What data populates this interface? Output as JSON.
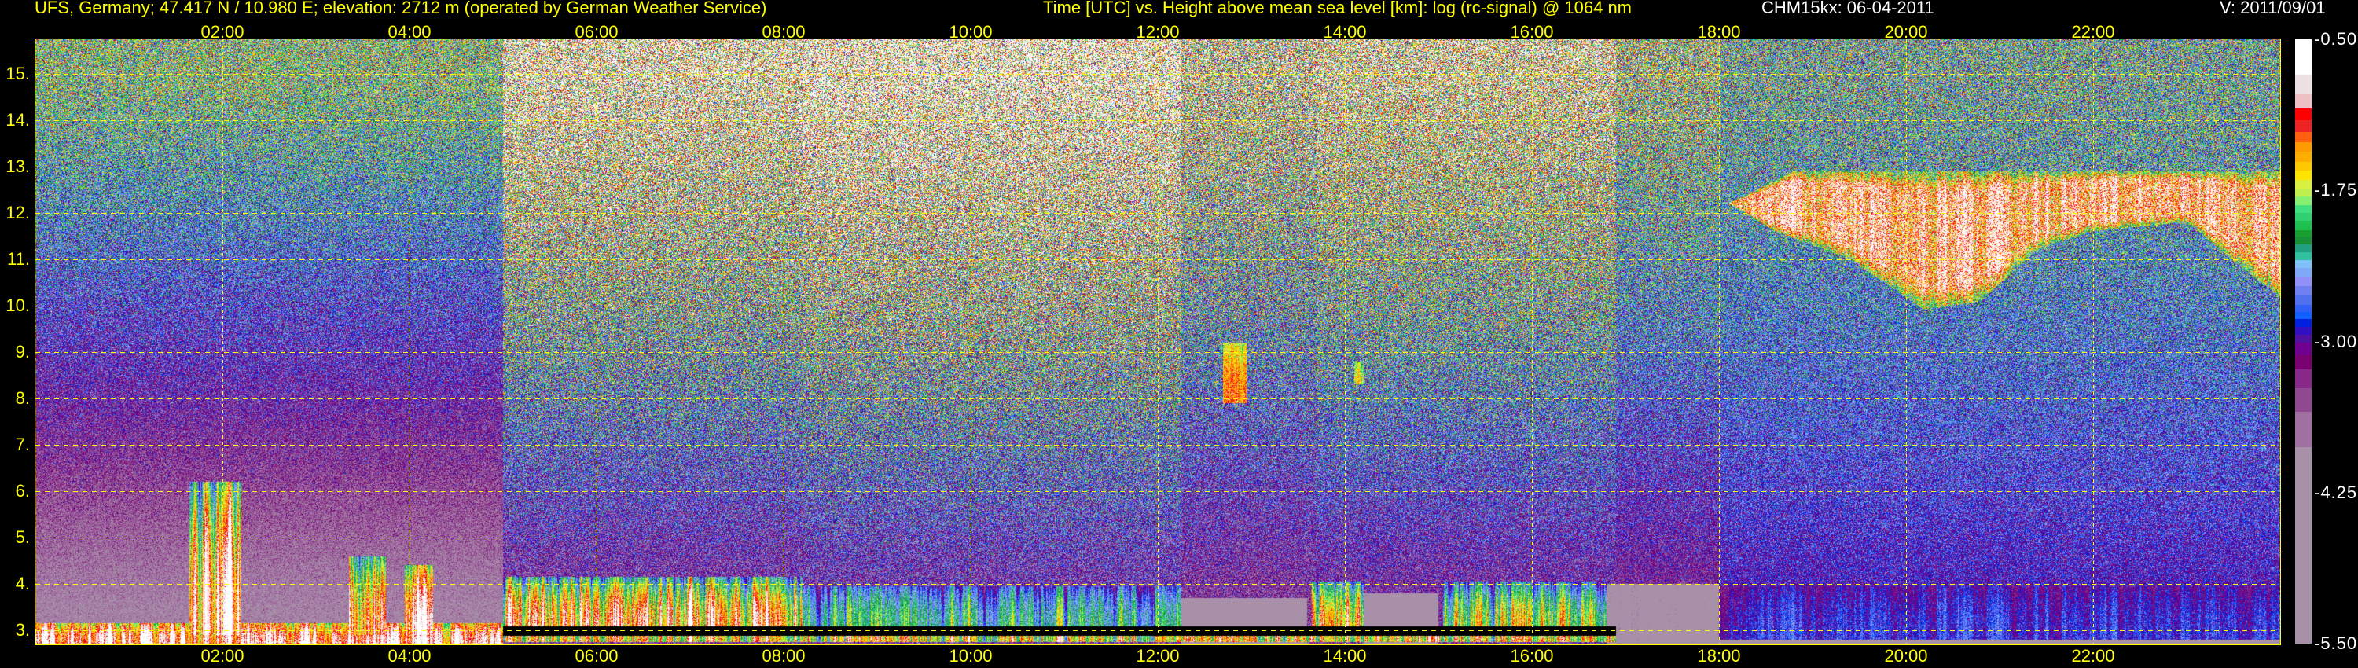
{
  "header": {
    "station": "UFS, Germany; 47.417 N / 10.980 E; elevation: 2712 m  (operated by German Weather Service)",
    "title": "Time [UTC] vs. Height above mean sea level [km]: log (rc-signal) @ 1064 nm",
    "instrument": "CHM15kx: 06-04-2011",
    "version": "V: 2011/09/01"
  },
  "colors": {
    "axis": "#ffff00",
    "grid": "#ffff00",
    "background": "#000000",
    "text_white": "#ffffff"
  },
  "chart_data": {
    "type": "heatmap",
    "title": "Time [UTC] vs. Height above mean sea level [km]: log (rc-signal) @ 1064 nm",
    "xlabel": "Time [UTC]",
    "ylabel": "Height above mean sea level [km]",
    "xlim": [
      0,
      24
    ],
    "ylim": [
      2.712,
      15.74
    ],
    "grid": true,
    "x_ticks": [
      2,
      4,
      6,
      8,
      10,
      12,
      14,
      16,
      18,
      20,
      22
    ],
    "x_tick_labels": [
      "02:00",
      "04:00",
      "06:00",
      "08:00",
      "10:00",
      "12:00",
      "14:00",
      "16:00",
      "18:00",
      "20:00",
      "22:00"
    ],
    "y_ticks": [
      3,
      4,
      5,
      6,
      7,
      8,
      9,
      10,
      11,
      12,
      13,
      14,
      15
    ],
    "y_tick_labels": [
      "3.",
      "4.",
      "5.",
      "6.",
      "7.",
      "8.",
      "9.",
      "10.",
      "11.",
      "12.",
      "13.",
      "14.",
      "15."
    ],
    "colorbar": {
      "range": [
        -5.5,
        -0.5
      ],
      "tick_values": [
        -0.5,
        -1.75,
        -3.0,
        -4.25,
        -5.5
      ],
      "tick_labels": [
        "-0.50",
        "-1.75",
        "-3.00",
        "-4.25",
        "-5.50"
      ],
      "segments": [
        {
          "from": -0.792,
          "to": -0.5,
          "color": "#ffffff"
        },
        {
          "from": -0.958,
          "to": -0.792,
          "color": "#ebe0e2"
        },
        {
          "from": -1.074,
          "to": -0.958,
          "color": "#efc0c4"
        },
        {
          "from": -1.169,
          "to": -1.074,
          "color": "#ff0000"
        },
        {
          "from": -1.268,
          "to": -1.169,
          "color": "#ee2424"
        },
        {
          "from": -1.352,
          "to": -1.268,
          "color": "#ff6010"
        },
        {
          "from": -1.433,
          "to": -1.352,
          "color": "#ff9a00"
        },
        {
          "from": -1.514,
          "to": -1.433,
          "color": "#ffae00"
        },
        {
          "from": -1.584,
          "to": -1.514,
          "color": "#ffc800"
        },
        {
          "from": -1.666,
          "to": -1.584,
          "color": "#ffe400"
        },
        {
          "from": -1.736,
          "to": -1.666,
          "color": "#d8f040"
        },
        {
          "from": -1.803,
          "to": -1.736,
          "color": "#bff050"
        },
        {
          "from": -1.87,
          "to": -1.803,
          "color": "#88f070"
        },
        {
          "from": -1.937,
          "to": -1.87,
          "color": "#40e080"
        },
        {
          "from": -2.0,
          "to": -1.937,
          "color": "#30d070"
        },
        {
          "from": -2.077,
          "to": -2.0,
          "color": "#20c050"
        },
        {
          "from": -2.13,
          "to": -2.077,
          "color": "#17a030"
        },
        {
          "from": -2.197,
          "to": -2.13,
          "color": "#189038"
        },
        {
          "from": -2.264,
          "to": -2.197,
          "color": "#20a080"
        },
        {
          "from": -2.324,
          "to": -2.264,
          "color": "#30c0a0"
        },
        {
          "from": -2.394,
          "to": -2.324,
          "color": "#80c0f8"
        },
        {
          "from": -2.465,
          "to": -2.394,
          "color": "#80a8f8"
        },
        {
          "from": -2.542,
          "to": -2.465,
          "color": "#9090f8"
        },
        {
          "from": -2.62,
          "to": -2.542,
          "color": "#7080f0"
        },
        {
          "from": -2.697,
          "to": -2.62,
          "color": "#5070f0"
        },
        {
          "from": -2.757,
          "to": -2.697,
          "color": "#3060f8"
        },
        {
          "from": -2.817,
          "to": -2.757,
          "color": "#1060ff"
        },
        {
          "from": -2.88,
          "to": -2.817,
          "color": "#0020e0"
        },
        {
          "from": -2.947,
          "to": -2.88,
          "color": "#3010c0"
        },
        {
          "from": -3.011,
          "to": -2.947,
          "color": "#5010a0"
        },
        {
          "from": -3.116,
          "to": -3.011,
          "color": "#700090"
        },
        {
          "from": -3.232,
          "to": -3.116,
          "color": "#780070"
        },
        {
          "from": -3.387,
          "to": -3.232,
          "color": "#882888"
        },
        {
          "from": -3.585,
          "to": -3.387,
          "color": "#904890"
        },
        {
          "from": -3.873,
          "to": -3.585,
          "color": "#a070a0"
        },
        {
          "from": -5.5,
          "to": -3.873,
          "color": "#a890a8"
        }
      ]
    },
    "background": [
      {
        "t": [
          0,
          5
        ],
        "low": -3.9,
        "high": -2.0,
        "noise": 0.55
      },
      {
        "t": [
          5,
          8.2
        ],
        "low": -3.4,
        "high": -1.2,
        "noise": 1.0
      },
      {
        "t": [
          8.2,
          12.25
        ],
        "low": -3.3,
        "high": -1.0,
        "noise": 1.1
      },
      {
        "t": [
          12.25,
          13.7
        ],
        "low": -3.4,
        "high": -1.6,
        "noise": 0.9
      },
      {
        "t": [
          13.7,
          16.9
        ],
        "low": -3.3,
        "high": -1.4,
        "noise": 0.9
      },
      {
        "t": [
          16.9,
          18
        ],
        "low": -3.3,
        "high": -1.9,
        "noise": 0.7
      },
      {
        "t": [
          18,
          24
        ],
        "low": -3.0,
        "high": -2.2,
        "noise": 0.6
      }
    ],
    "features": [
      {
        "name": "surface-layer-night",
        "t": [
          0,
          5
        ],
        "h": [
          2.712,
          3.15
        ],
        "v": -1.0,
        "fade": 0.6,
        "streak": 0.4
      },
      {
        "name": "convective-plume",
        "t": [
          1.65,
          2.2
        ],
        "h": [
          2.9,
          6.2
        ],
        "v": -0.8,
        "fade": 1.2,
        "streak": 0.6
      },
      {
        "name": "convective-plume",
        "t": [
          3.35,
          3.75
        ],
        "h": [
          2.9,
          4.6
        ],
        "v": -1.3,
        "fade": 1.0,
        "streak": 0.6
      },
      {
        "name": "convective-plume",
        "t": [
          3.95,
          4.25
        ],
        "h": [
          2.9,
          4.4
        ],
        "v": -1.0,
        "fade": 1.0,
        "streak": 0.5
      },
      {
        "name": "boundary-layer",
        "t": [
          5.0,
          8.2
        ],
        "h": [
          3.08,
          4.15
        ],
        "v": -1.3,
        "fade": 1.1,
        "streak": 0.6
      },
      {
        "name": "boundary-layer",
        "t": [
          8.2,
          12.25
        ],
        "h": [
          3.08,
          3.95
        ],
        "v": -2.15,
        "fade": 0.6,
        "streak": 0.4
      },
      {
        "name": "no-signal-gap",
        "t": [
          12.25,
          13.6
        ],
        "h": [
          2.712,
          3.7
        ],
        "v": -4.6,
        "fade": 0,
        "streak": 0.2
      },
      {
        "name": "boundary-layer",
        "t": [
          13.65,
          14.2
        ],
        "h": [
          3.08,
          4.05
        ],
        "v": -1.4,
        "fade": 1.0,
        "streak": 0.5
      },
      {
        "name": "no-signal-gap",
        "t": [
          14.2,
          15.0
        ],
        "h": [
          2.712,
          3.8
        ],
        "v": -4.6,
        "fade": 0,
        "streak": 0.2
      },
      {
        "name": "boundary-layer",
        "t": [
          15.05,
          16.8
        ],
        "h": [
          3.08,
          4.05
        ],
        "v": -1.8,
        "fade": 0.9,
        "streak": 0.5
      },
      {
        "name": "evening-gap",
        "t": [
          16.8,
          18.0
        ],
        "h": [
          2.712,
          4.0
        ],
        "v": -4.3,
        "fade": 0,
        "streak": 0.2
      },
      {
        "name": "residual-layer",
        "t": [
          18.0,
          24
        ],
        "h": [
          2.8,
          3.95
        ],
        "v": -2.85,
        "fade": 0.2,
        "streak": 0.15
      },
      {
        "name": "surface-thin",
        "t": [
          18.0,
          24
        ],
        "h": [
          2.712,
          2.8
        ],
        "v": -4.5,
        "fade": 0,
        "streak": 0
      },
      {
        "name": "no-signal-band",
        "t": [
          5.0,
          16.9
        ],
        "h": [
          2.88,
          3.08
        ],
        "v": -9,
        "fade": 0,
        "streak": 0
      },
      {
        "name": "surface-layer-day",
        "t": [
          5.0,
          16.9
        ],
        "h": [
          2.74,
          2.88
        ],
        "v": -1.6,
        "fade": 0,
        "streak": 0.6
      },
      {
        "name": "aerosol-patch",
        "t": [
          12.7,
          12.95
        ],
        "h": [
          7.9,
          9.2
        ],
        "v": -1.4,
        "fade": 0.4,
        "streak": 0.2
      },
      {
        "name": "aerosol-patch",
        "t": [
          14.1,
          14.2
        ],
        "h": [
          8.3,
          8.8
        ],
        "v": -1.6,
        "fade": 0.3,
        "streak": 0.2
      }
    ],
    "cirrus_cloud": {
      "v": -1.1,
      "top": [
        [
          18.1,
          12.2
        ],
        [
          18.8,
          12.9
        ],
        [
          24,
          12.9
        ]
      ],
      "base": [
        [
          18.1,
          12.2
        ],
        [
          18.6,
          11.6
        ],
        [
          19.4,
          11.0
        ],
        [
          20.2,
          9.9
        ],
        [
          20.8,
          10.1
        ],
        [
          21.4,
          11.2
        ],
        [
          22.0,
          11.6
        ],
        [
          23.0,
          11.8
        ],
        [
          23.6,
          10.8
        ],
        [
          24,
          10.2
        ]
      ]
    }
  }
}
